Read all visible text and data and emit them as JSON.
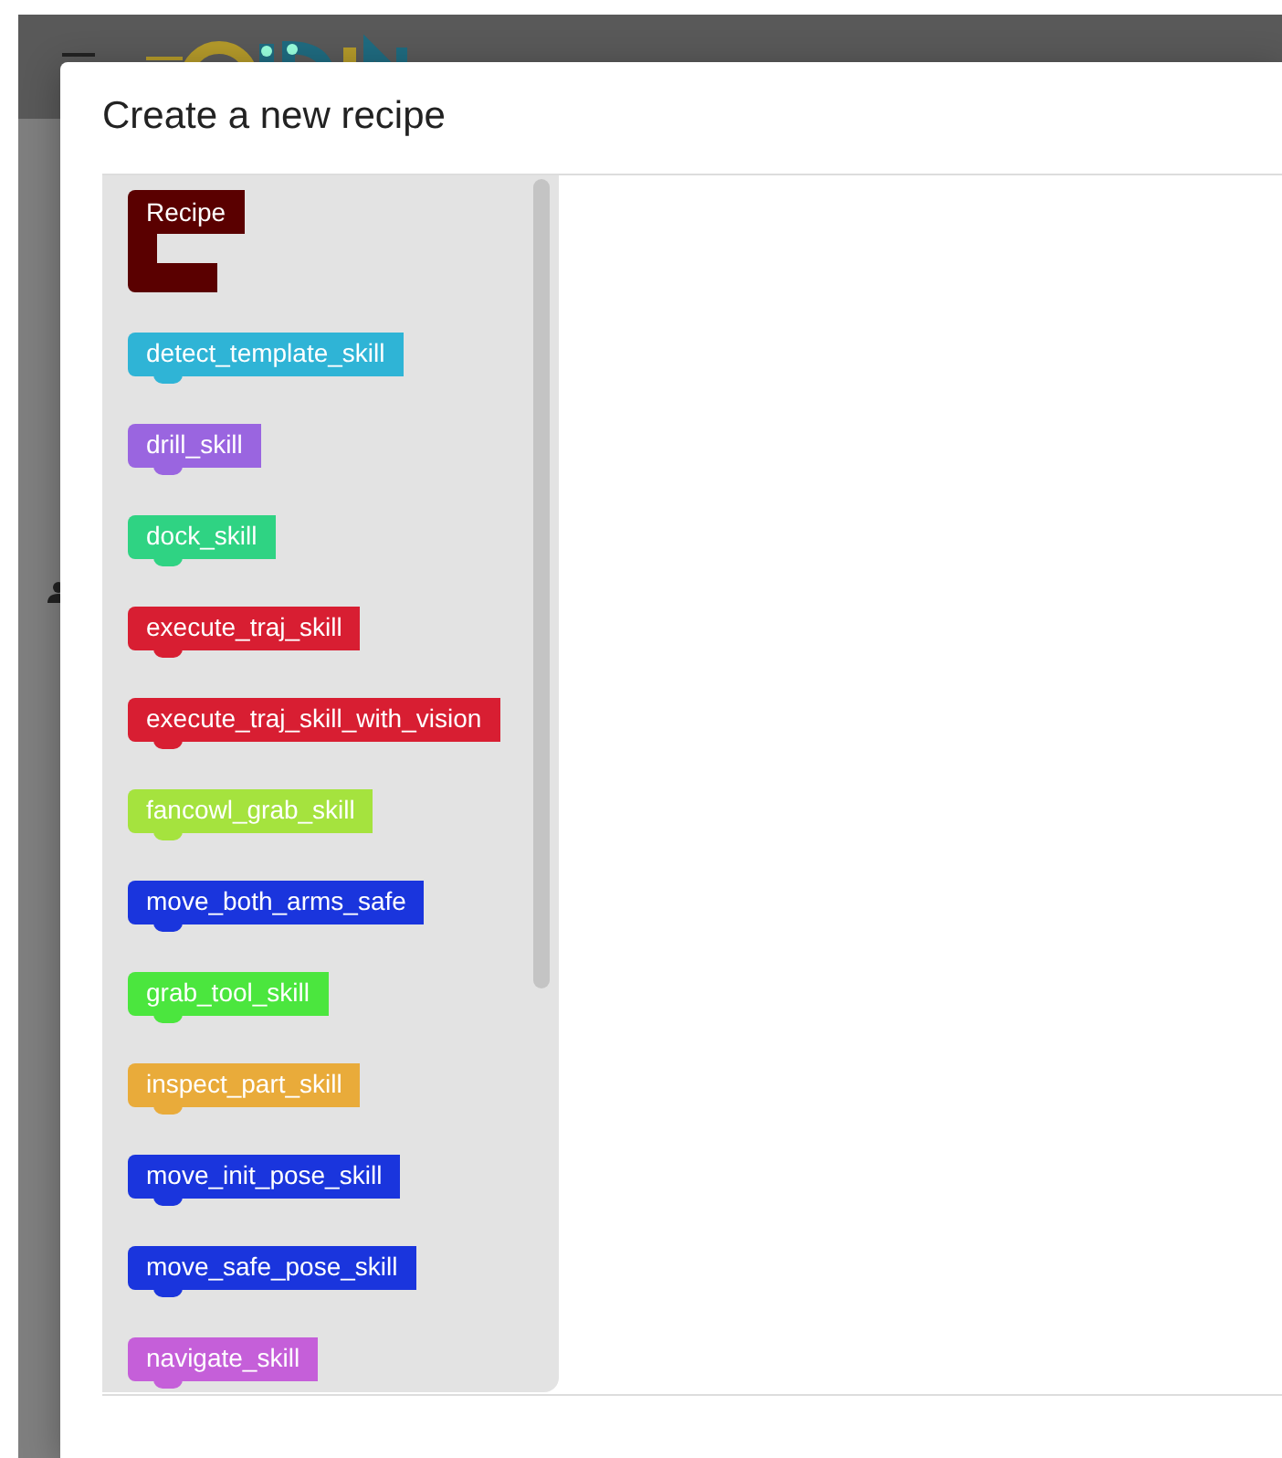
{
  "dialog": {
    "title": "Create a new recipe"
  },
  "toolbox": {
    "blocks": [
      {
        "label": "Recipe",
        "kind": "container",
        "color": "#5a0000"
      },
      {
        "label": "detect_template_skill",
        "kind": "statement",
        "color": "#2fb4d6"
      },
      {
        "label": "drill_skill",
        "kind": "statement",
        "color": "#9a65e0"
      },
      {
        "label": "dock_skill",
        "kind": "statement",
        "color": "#2fd383"
      },
      {
        "label": "execute_traj_skill",
        "kind": "statement",
        "color": "#d81e32"
      },
      {
        "label": "execute_traj_skill_with_vision",
        "kind": "statement",
        "color": "#d81e32"
      },
      {
        "label": "fancowl_grab_skill",
        "kind": "statement",
        "color": "#a5e33e"
      },
      {
        "label": "move_both_arms_safe",
        "kind": "statement",
        "color": "#1a35dd"
      },
      {
        "label": "grab_tool_skill",
        "kind": "statement",
        "color": "#4be63e"
      },
      {
        "label": "inspect_part_skill",
        "kind": "statement",
        "color": "#e9ab3a"
      },
      {
        "label": "move_init_pose_skill",
        "kind": "statement",
        "color": "#1a35dd"
      },
      {
        "label": "move_safe_pose_skill",
        "kind": "statement",
        "color": "#1a35dd"
      },
      {
        "label": "navigate_skill",
        "kind": "statement",
        "color": "#c55fd9"
      }
    ]
  }
}
